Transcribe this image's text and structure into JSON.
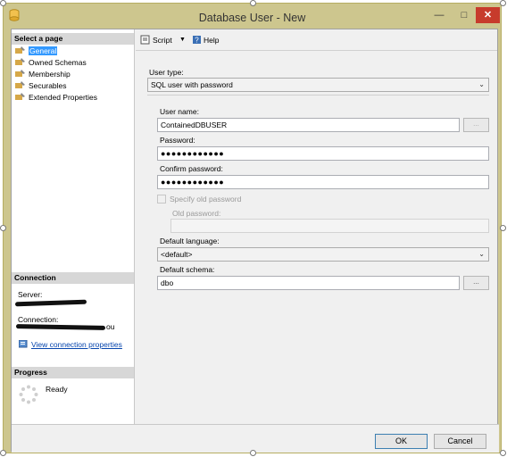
{
  "window": {
    "title": "Database User - New",
    "min_glyph": "—",
    "max_glyph": "□",
    "close_glyph": "✕"
  },
  "left": {
    "select_page_header": "Select a page",
    "pages": [
      {
        "label": "General",
        "selected": true
      },
      {
        "label": "Owned Schemas",
        "selected": false
      },
      {
        "label": "Membership",
        "selected": false
      },
      {
        "label": "Securables",
        "selected": false
      },
      {
        "label": "Extended Properties",
        "selected": false
      }
    ],
    "connection_header": "Connection",
    "server_label": "Server:",
    "connection_label": "Connection:",
    "connection_value_fragment": "ou",
    "view_connection_link": "View connection properties",
    "progress_header": "Progress",
    "progress_status": "Ready"
  },
  "toolbar": {
    "script_label": "Script",
    "help_label": "Help"
  },
  "form": {
    "user_type_label": "User type:",
    "user_type_value": "SQL user with password",
    "user_name_label": "User name:",
    "user_name_value": "ContainedDBUSER",
    "password_label": "Password:",
    "password_value": "●●●●●●●●●●●●",
    "confirm_password_label": "Confirm password:",
    "confirm_password_value": "●●●●●●●●●●●●",
    "specify_old_password_label": "Specify old password",
    "old_password_label": "Old password:",
    "default_language_label": "Default language:",
    "default_language_value": "<default>",
    "default_schema_label": "Default schema:",
    "default_schema_value": "dbo",
    "ellipsis": "..."
  },
  "buttons": {
    "ok": "OK",
    "cancel": "Cancel"
  },
  "colors": {
    "frame": "#cdc68e",
    "close_button": "#c73b2c",
    "selection": "#3399ff",
    "link": "#0645ad"
  }
}
